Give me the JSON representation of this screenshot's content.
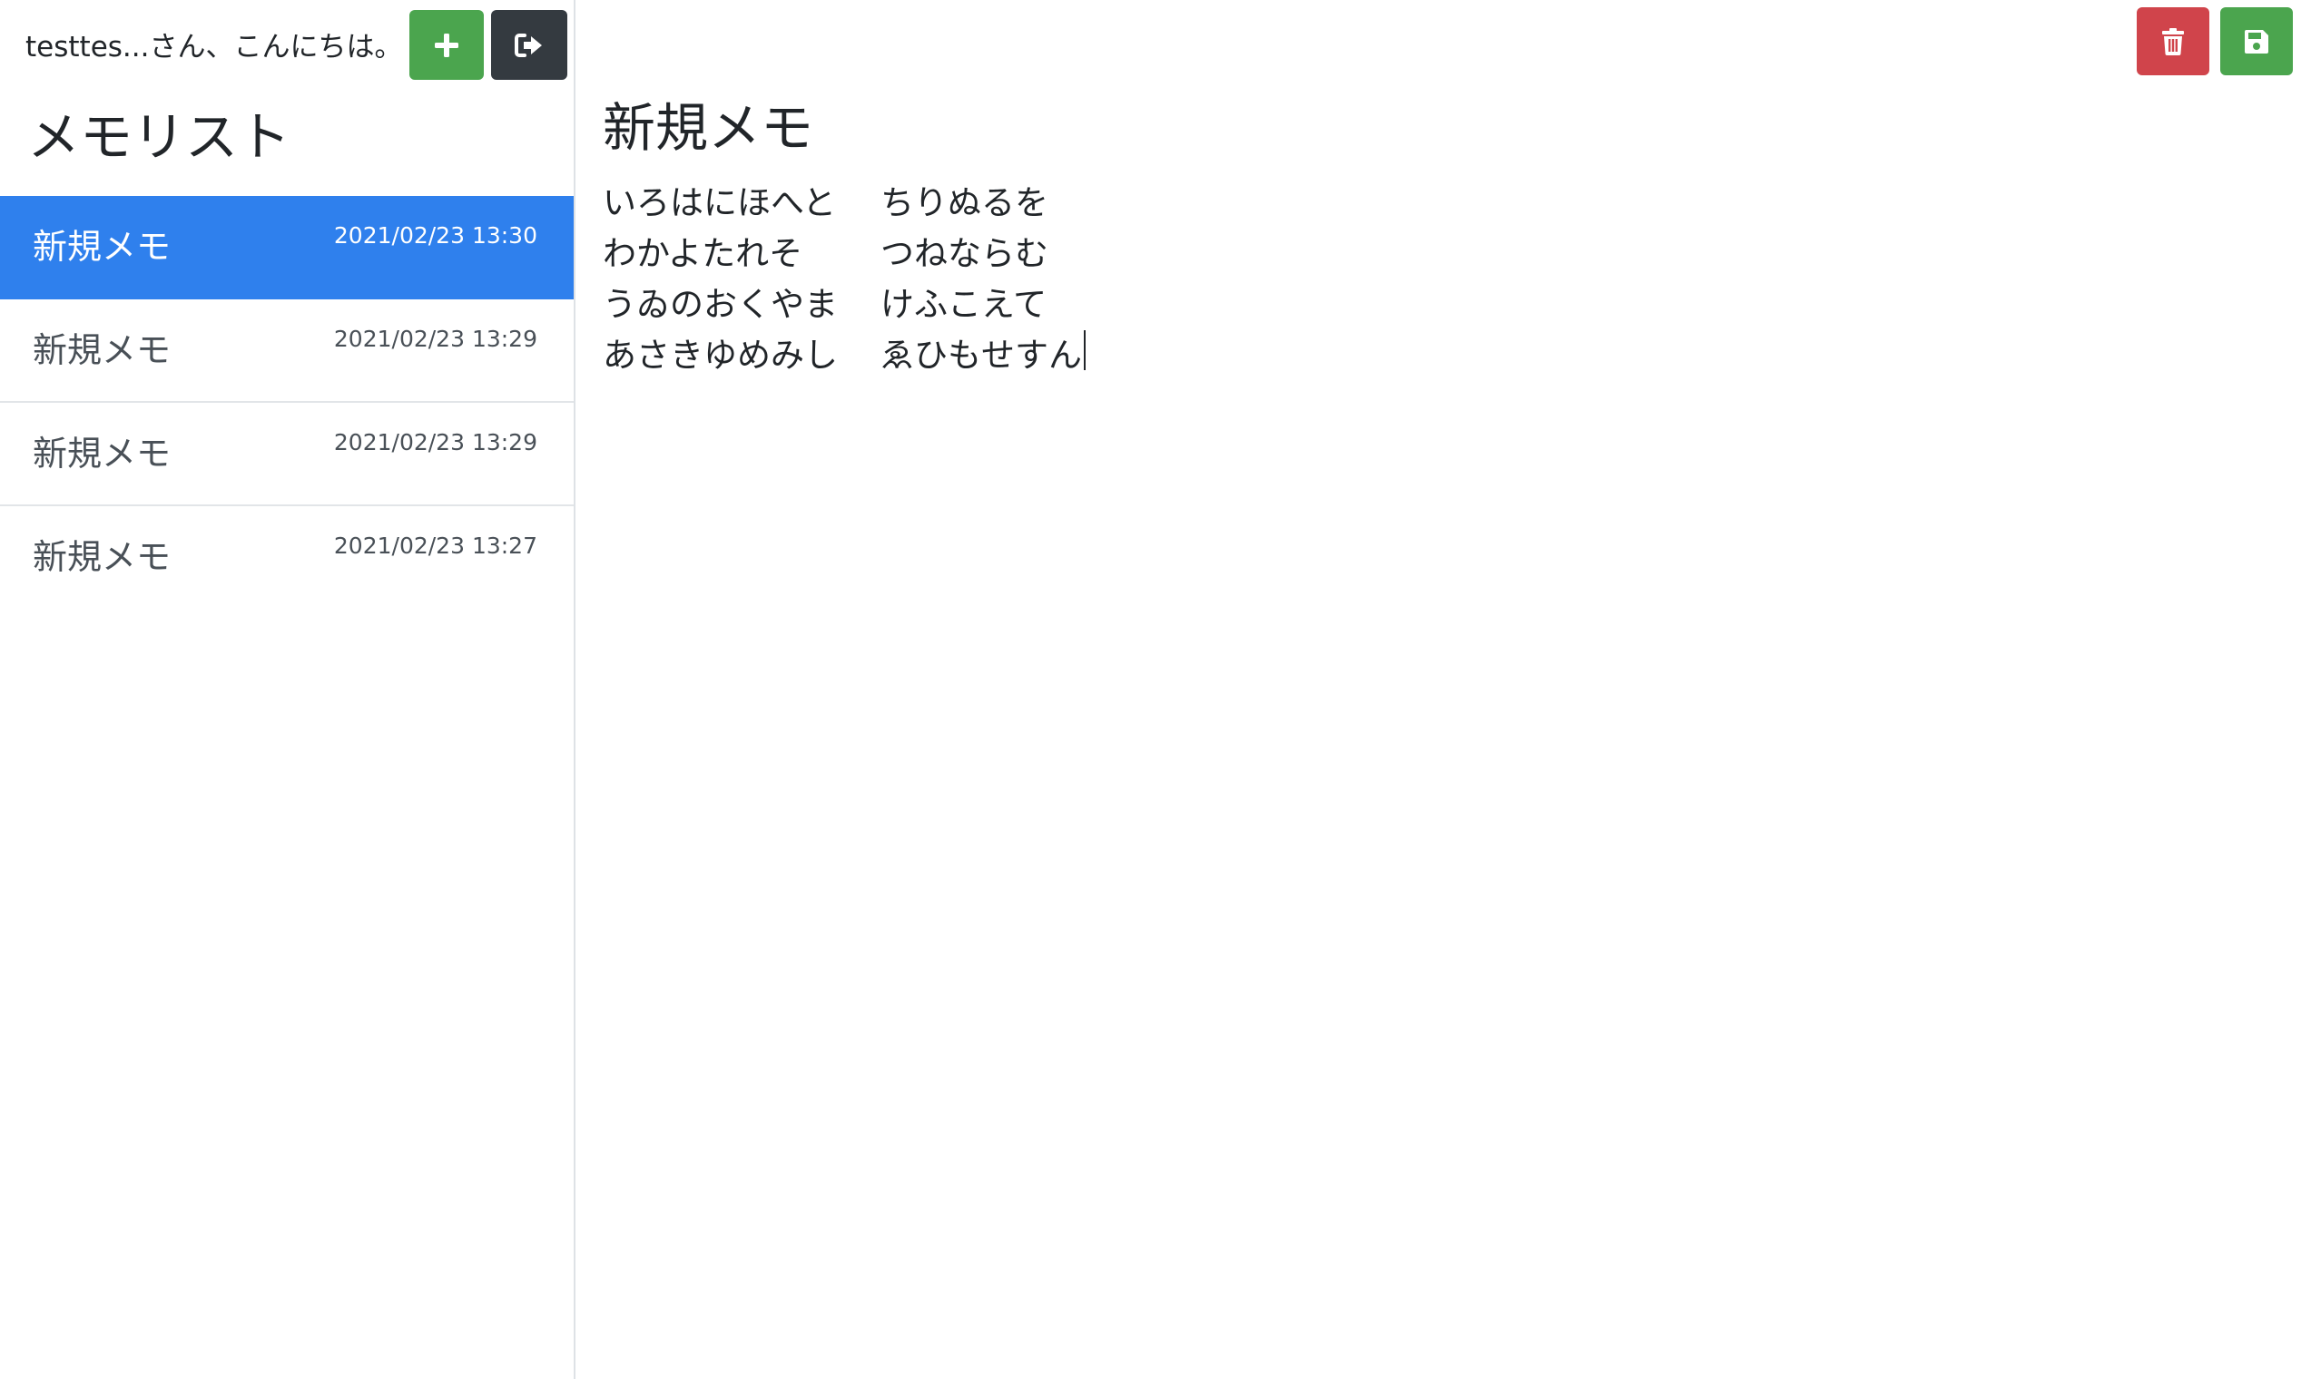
{
  "sidebar": {
    "greeting": "testtes...さん、こんにちは。",
    "add_button_icon": "plus-icon",
    "logout_button_icon": "sign-out-icon",
    "list_title": "メモリスト",
    "items": [
      {
        "title": "新規メモ",
        "date": "2021/02/23 13:30",
        "active": true
      },
      {
        "title": "新規メモ",
        "date": "2021/02/23 13:29",
        "active": false
      },
      {
        "title": "新規メモ",
        "date": "2021/02/23 13:29",
        "active": false
      },
      {
        "title": "新規メモ",
        "date": "2021/02/23 13:27",
        "active": false
      }
    ]
  },
  "editor": {
    "delete_button_icon": "trash-icon",
    "save_button_icon": "floppy-disk-icon",
    "title": "新規メモ",
    "lines": [
      {
        "a": "いろはにほへと",
        "b": "ちりぬるを"
      },
      {
        "a": "わかよたれそ",
        "b": "つねならむ"
      },
      {
        "a": "うゐのおくやま",
        "b": "けふこえて"
      },
      {
        "a": "あさきゆめみし",
        "b": "ゑひもせすん"
      }
    ]
  },
  "colors": {
    "accent_active": "#2f80ed",
    "add_green": "#4ba54e",
    "logout_dark": "#343a40",
    "delete_red": "#d0444b",
    "save_green": "#4ba54e"
  }
}
